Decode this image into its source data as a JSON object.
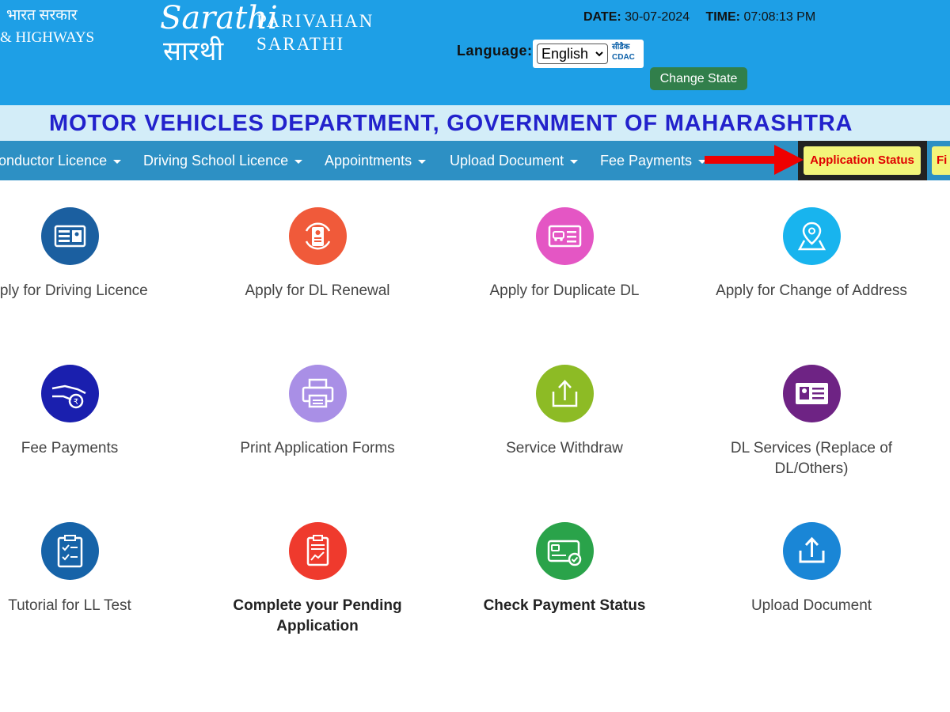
{
  "header": {
    "gov_line1": "भारत सरकार",
    "gov_line2": "& HIGHWAYS",
    "logo_latin": "Sarathi",
    "logo_devanagari": "सारथी",
    "brand_line1": "PARIVAHAN",
    "brand_line2": "SARATHI",
    "date_label": "DATE:",
    "date_value": "30-07-2024",
    "time_label": "TIME:",
    "time_value": "07:08:13 PM",
    "language_label": "Language:",
    "language_selected": "English",
    "cdac_line1": "सीडैक",
    "cdac_line2": "CDAC",
    "change_state": "Change State"
  },
  "department_title": "MOTOR VEHICLES DEPARTMENT, GOVERNMENT OF MAHARASHTRA",
  "nav": {
    "items": [
      {
        "label": "onductor Licence"
      },
      {
        "label": "Driving School Licence"
      },
      {
        "label": "Appointments"
      },
      {
        "label": "Upload Document"
      },
      {
        "label": "Fee Payments"
      }
    ],
    "application_status": "Application Status",
    "partial_button": "Fi"
  },
  "colors": {
    "header_bg": "#1e9fe6",
    "nav_bg": "#2d90c4",
    "dept_band": "#d3edf8",
    "dept_text": "#2222cc",
    "highlight_btn": "#f3f57a",
    "highlight_text": "#e00000",
    "arrow": "#ee0000"
  },
  "tiles": [
    {
      "label": "pply for Driving Licence",
      "icon": "id-card-icon",
      "color": "#1b5fa0"
    },
    {
      "label": "Apply for DL Renewal",
      "icon": "renewal-icon",
      "color": "#f05a3a"
    },
    {
      "label": "Apply for Duplicate DL",
      "icon": "duplicate-dl-icon",
      "color": "#e456c4"
    },
    {
      "label": "Apply for Change of Address",
      "icon": "location-pin-icon",
      "color": "#18b4ee"
    },
    {
      "label": "Fee Payments",
      "icon": "payment-hand-icon",
      "color": "#1a1fae"
    },
    {
      "label": "Print Application Forms",
      "icon": "printer-icon",
      "color": "#a98fe6"
    },
    {
      "label": "Service Withdraw",
      "icon": "withdraw-icon",
      "color": "#8dbb25"
    },
    {
      "label": "DL Services (Replace of DL/Others)",
      "icon": "dl-services-icon",
      "color": "#6e2384"
    },
    {
      "label": "Tutorial for LL Test",
      "icon": "checklist-icon",
      "color": "#1663a8"
    },
    {
      "label": "Complete your Pending Application",
      "icon": "pending-application-icon",
      "color": "#ef3a2d"
    },
    {
      "label": "Check Payment Status",
      "icon": "payment-status-icon",
      "color": "#2aa34a"
    },
    {
      "label": "Upload Document",
      "icon": "upload-icon",
      "color": "#1a86d6"
    }
  ]
}
